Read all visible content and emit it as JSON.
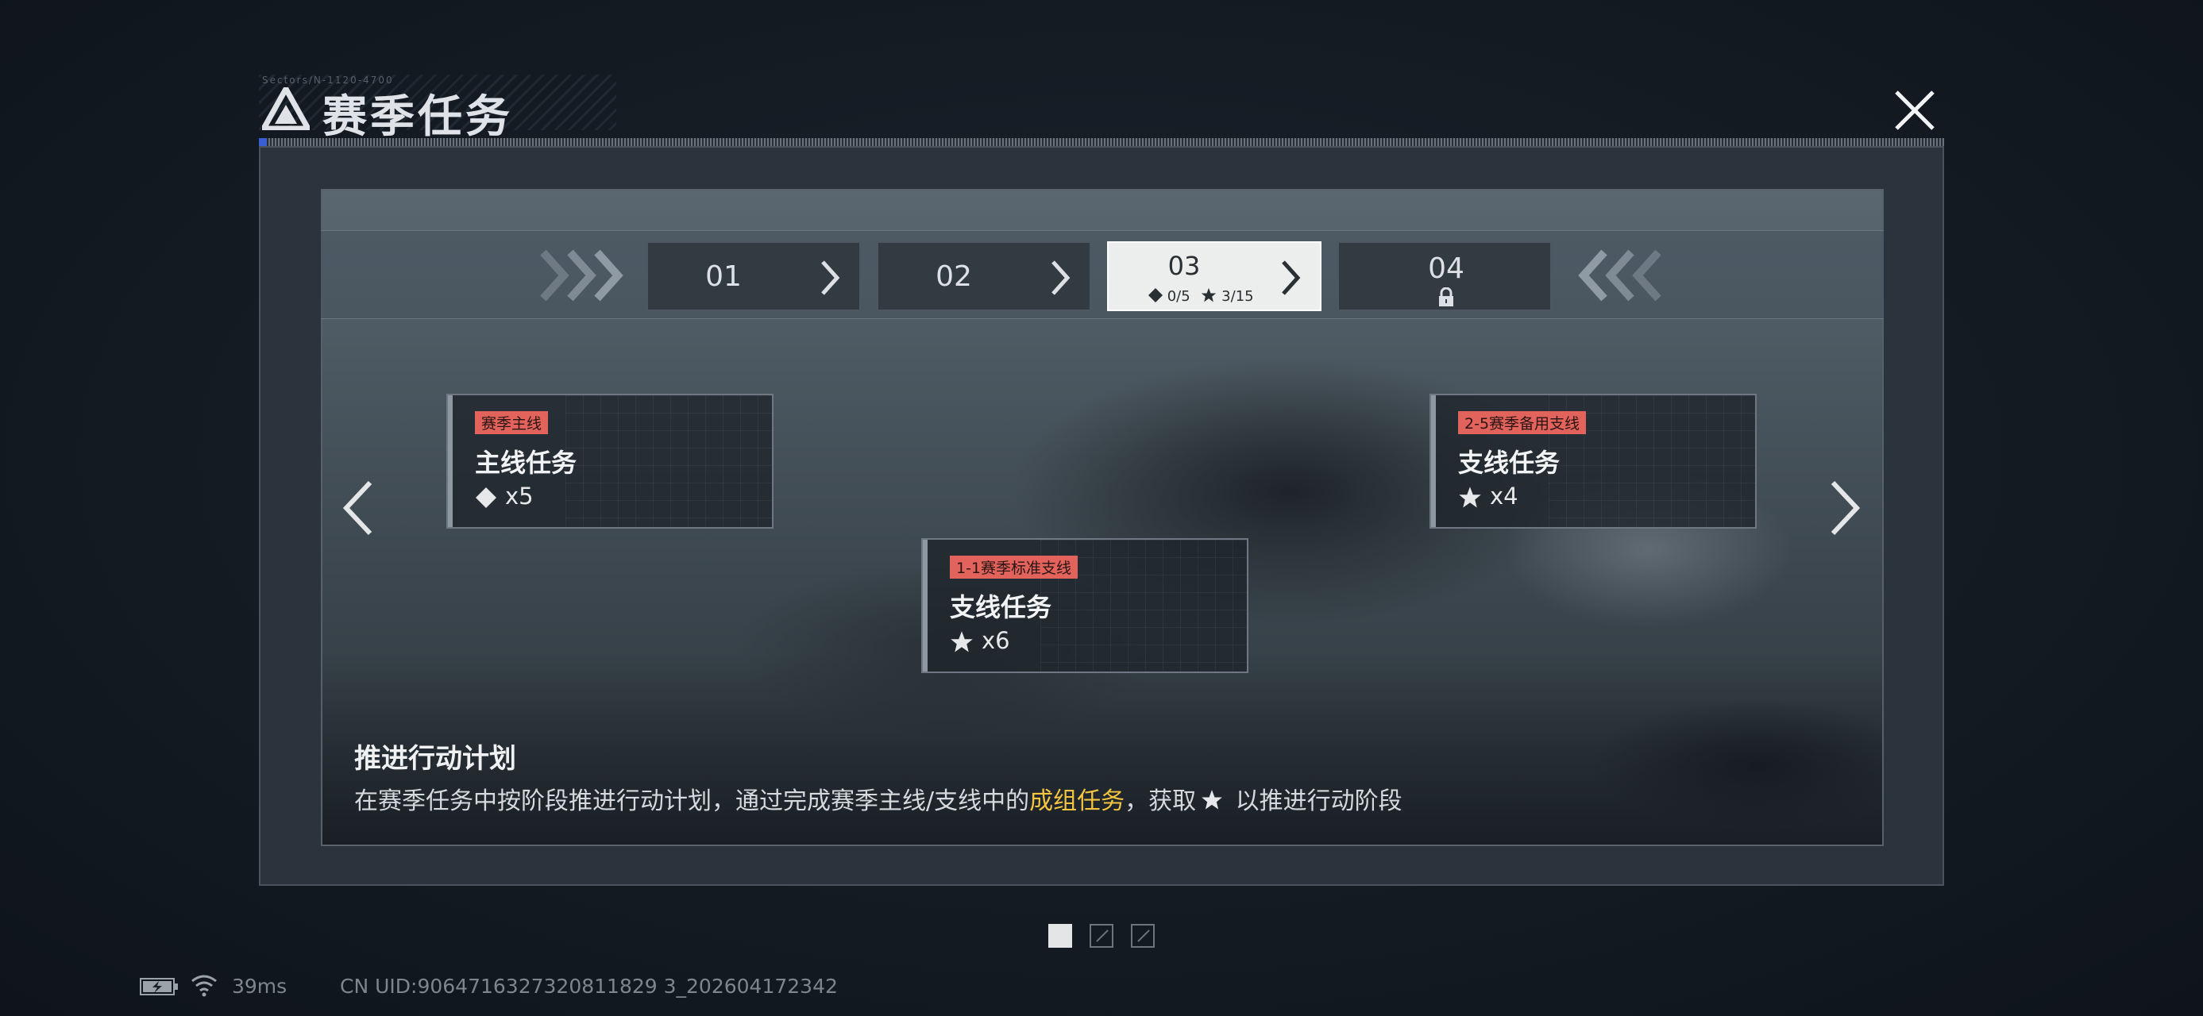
{
  "header": {
    "micro_text": "Sectors/N-1120-4700",
    "title": "赛季任务",
    "close_icon": "close-icon",
    "logo_icon": "triangle-logo-icon"
  },
  "stages": [
    {
      "num": "01",
      "state": "normal"
    },
    {
      "num": "02",
      "state": "normal"
    },
    {
      "num": "03",
      "state": "active",
      "diamond_progress": "0/5",
      "star_progress": "3/15"
    },
    {
      "num": "04",
      "state": "locked",
      "icon": "lock-icon"
    }
  ],
  "cards": [
    {
      "tag": "赛季主线",
      "title": "主线任务",
      "icon": "diamond-icon",
      "count": "x5"
    },
    {
      "tag": "1-1赛季标准支线",
      "title": "支线任务",
      "icon": "star-icon",
      "count": "x6"
    },
    {
      "tag": "2-5赛季备用支线",
      "title": "支线任务",
      "icon": "star-icon",
      "count": "x4"
    }
  ],
  "info": {
    "title": "推进行动计划",
    "desc_before": "在赛季任务中按阶段推进行动计划，通过完成赛季主线/支线中的",
    "desc_highlight": "成组任务",
    "desc_middle": "，获取",
    "desc_after": " 以推进行动阶段"
  },
  "pagination": {
    "current": 1,
    "total": 3
  },
  "status_bar": {
    "ping": "39ms",
    "uid": "CN UID:9064716327320811829 3_202604172342"
  },
  "colors": {
    "tag_red": "#e2635b",
    "highlight_yellow": "#f5c542",
    "active_tab": "#eceded"
  }
}
